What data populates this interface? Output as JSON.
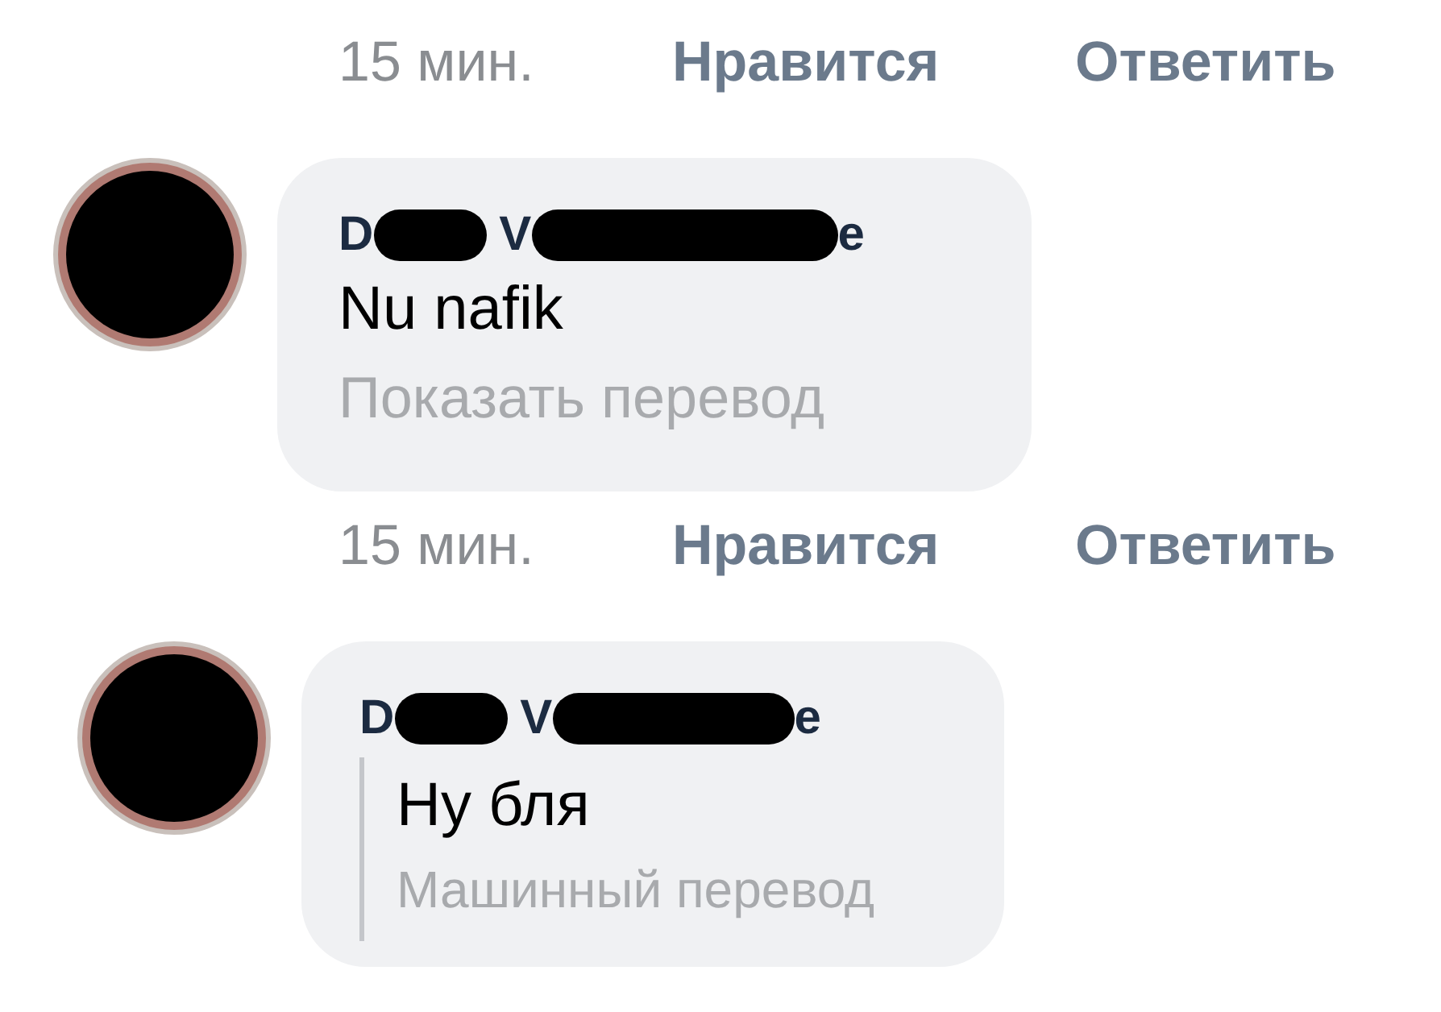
{
  "top_actions": {
    "time": "15 мин.",
    "like": "Нравится",
    "reply": "Ответить"
  },
  "comments": [
    {
      "kind": "with_translate_link",
      "reply": false,
      "name_parts": [
        "D",
        "V",
        "e"
      ],
      "text": "Nu nafik",
      "translation_note": "Показать перевод",
      "actions": {
        "time": "15 мин.",
        "like": "Нравится",
        "reply": "Ответить"
      }
    },
    {
      "kind": "translated",
      "reply": true,
      "name_parts": [
        "D",
        "V",
        "e"
      ],
      "text": "Ну бля",
      "translation_note": "Машинный перевод"
    }
  ]
}
